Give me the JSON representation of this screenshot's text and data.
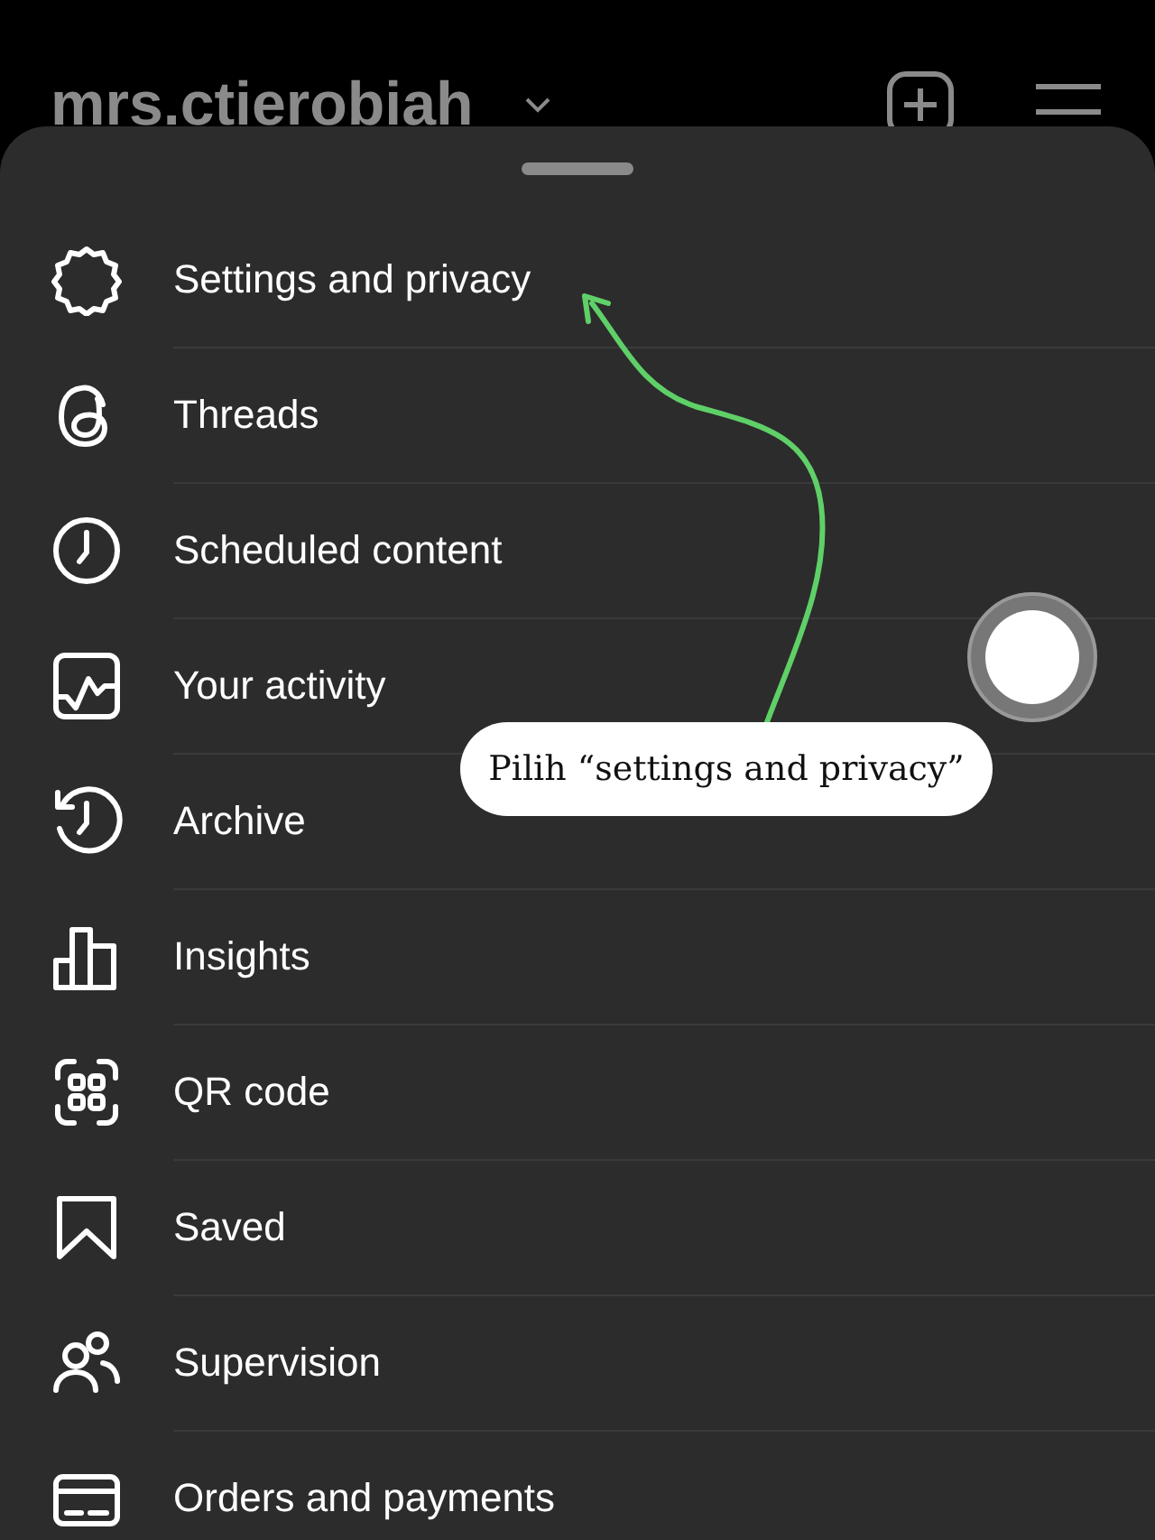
{
  "header": {
    "username": "mrs.ctierobiah"
  },
  "menu": [
    {
      "kind": "settings",
      "label": "Settings and privacy"
    },
    {
      "kind": "threads",
      "label": "Threads"
    },
    {
      "kind": "clock",
      "label": "Scheduled content"
    },
    {
      "kind": "activity",
      "label": "Your activity"
    },
    {
      "kind": "archive",
      "label": "Archive"
    },
    {
      "kind": "insights",
      "label": "Insights"
    },
    {
      "kind": "qr",
      "label": "QR code"
    },
    {
      "kind": "saved",
      "label": "Saved"
    },
    {
      "kind": "supervision",
      "label": "Supervision"
    },
    {
      "kind": "card",
      "label": "Orders and payments"
    }
  ],
  "annotation": {
    "text": "Pilih “settings and privacy”"
  }
}
